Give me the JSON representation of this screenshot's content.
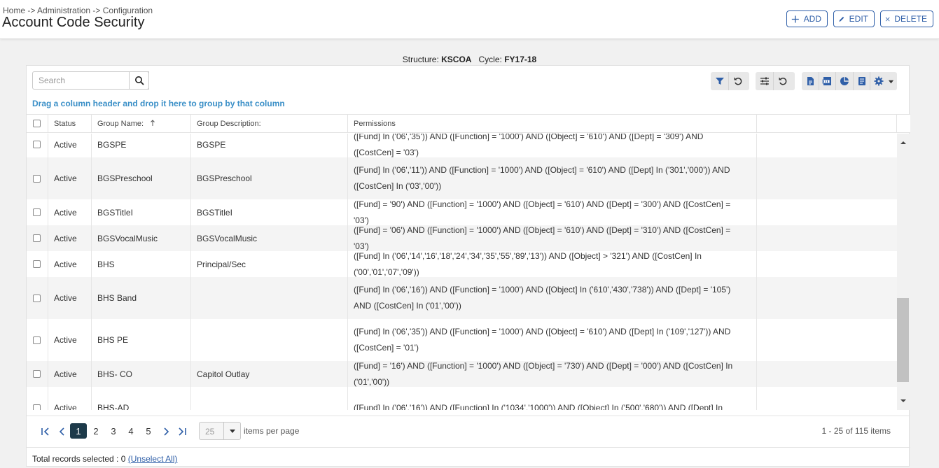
{
  "header": {
    "breadcrumb": "Home -> Administration -> Configuration",
    "title": "Account Code Security",
    "buttons": {
      "add": "ADD",
      "edit": "EDIT",
      "delete": "DELETE"
    }
  },
  "structure": {
    "structure_label": "Structure:",
    "structure_value": "KSCOA",
    "cycle_label": "Cycle:",
    "cycle_value": "FY17-18"
  },
  "toolbar": {
    "search_placeholder": "Search",
    "group_hint": "Drag a column header and drop it here to group by that column"
  },
  "columns": [
    "Status",
    "Group Name:",
    "Group Description:",
    "Permissions"
  ],
  "rows": [
    {
      "status": "Active",
      "name": "BGSPE",
      "desc": "BGSPE",
      "perm": "([Fund] In ('06','35')) AND ([Function] = '1000') AND ([Object] = '610') AND ([Dept] = '309') AND ([CostCen] = '03')"
    },
    {
      "status": "Active",
      "name": "BGSPreschool",
      "desc": "BGSPreschool",
      "perm": "([Fund] In ('06','11')) AND ([Function] = '1000') AND ([Object] = '610') AND ([Dept] In ('301','000')) AND ([CostCen] In ('03','00'))"
    },
    {
      "status": "Active",
      "name": "BGSTitleI",
      "desc": "BGSTitleI",
      "perm": "([Fund] = '90') AND ([Function] = '1000') AND ([Object] = '610') AND ([Dept] = '300') AND ([CostCen] = '03')"
    },
    {
      "status": "Active",
      "name": "BGSVocalMusic",
      "desc": "BGSVocalMusic",
      "perm": "([Fund] = '06') AND ([Function] = '1000') AND ([Object] = '610') AND ([Dept] = '310') AND ([CostCen] = '03')"
    },
    {
      "status": "Active",
      "name": "BHS",
      "desc": "Principal/Sec",
      "perm": "([Fund] In ('06','14','16','18','24','34','35','55','89','13')) AND ([Object] > '321') AND ([CostCen] In ('00','01','07','09'))"
    },
    {
      "status": "Active",
      "name": "BHS Band",
      "desc": "",
      "perm": "([Fund] In ('06','16')) AND ([Function] = '1000') AND ([Object] In ('610','430','738')) AND ([Dept] = '105') AND ([CostCen] In ('01','00'))"
    },
    {
      "status": "Active",
      "name": "BHS PE",
      "desc": "",
      "perm": "([Fund] In ('06','35')) AND ([Function] = '1000') AND ([Object] = '610') AND ([Dept] In ('109','127')) AND ([CostCen] = '01')"
    },
    {
      "status": "Active",
      "name": "BHS- CO",
      "desc": "Capitol Outlay",
      "perm": "([Fund] = '16') AND ([Function] = '1000') AND ([Object] = '730') AND ([Dept] = '000') AND ([CostCen] In ('01','00'))"
    },
    {
      "status": "Active",
      "name": "BHS-AD",
      "desc": "",
      "perm": "([Fund] In ('06','16')) AND ([Function] In ('1034','1000')) AND ([Object] In ('500','680')) AND ([Dept] In"
    }
  ],
  "pager": {
    "pages": [
      "1",
      "2",
      "3",
      "4",
      "5"
    ],
    "current_page": "1",
    "page_size": "25",
    "items_per_page": "items per page",
    "range": "1 - 25 of 115 items"
  },
  "footer": {
    "text": "Total records selected : 0",
    "link": "(Unselect All)"
  },
  "colors": {
    "accent": "#2f5fa8",
    "hint": "#3a8fc7",
    "active_page": "#1d3a4a"
  }
}
